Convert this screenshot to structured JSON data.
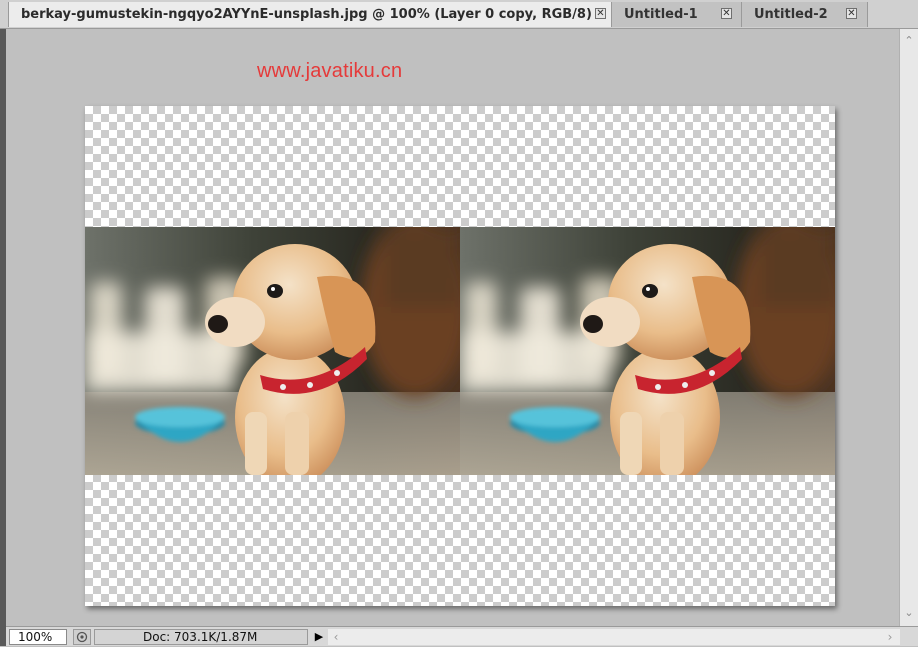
{
  "tabs": [
    {
      "label": "berkay-gumustekin-ngqyo2AYYnE-unsplash.jpg @ 100% (Layer 0 copy, RGB/8) *",
      "active": true
    },
    {
      "label": "Untitled-1",
      "active": false
    },
    {
      "label": "Untitled-2",
      "active": false
    }
  ],
  "icons": {
    "tab_close": "close-icon",
    "status": "navigator-icon",
    "menu": "triangle-right-icon",
    "scroll_up": "chevron-up-icon",
    "scroll_down": "chevron-down-icon",
    "scroll_left": "chevron-left-icon",
    "scroll_right": "chevron-right-icon"
  },
  "tab_close_glyph": "✕",
  "watermark": "www.javatiku.cn",
  "status": {
    "zoom": "100%",
    "doc_info": "Doc: 703.1K/1.87M",
    "menu_glyph": "▶"
  },
  "scroll_glyphs": {
    "up": "⌃",
    "down": "⌄",
    "left": "‹",
    "right": "›"
  },
  "colors": {
    "workspace": "#c0c0c0",
    "watermark": "#e53a3a",
    "collar": "#c8242f",
    "bowl": "#2fa6c4"
  }
}
